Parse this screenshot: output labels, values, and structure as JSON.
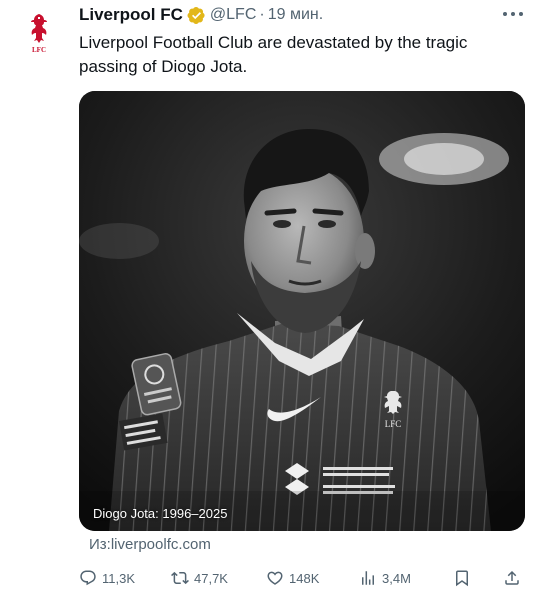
{
  "tweet": {
    "author_name": "Liverpool FC",
    "handle": "@LFC",
    "separator": "·",
    "time": "19 мин.",
    "text": "Liverpool Football Club are devastated by the tragic passing of Diogo Jota.",
    "media_caption": "Diogo Jota: 1996–2025",
    "source_link": "Из:liverpoolfc.com",
    "avatar_logo_text": "LFC"
  },
  "actions": {
    "replies": "11,3K",
    "retweets": "47,7K",
    "likes": "148K",
    "views": "3,4M"
  },
  "icons": {
    "verified": "verified-badge-icon",
    "more": "more-icon",
    "reply": "reply-icon",
    "retweet": "retweet-icon",
    "like": "heart-icon",
    "views": "views-icon",
    "bookmark": "bookmark-icon",
    "share": "share-icon"
  },
  "colors": {
    "brand_red": "#c8102e",
    "verified_gold": "#e2b719",
    "text_primary": "#0f1419",
    "text_secondary": "#536471"
  }
}
